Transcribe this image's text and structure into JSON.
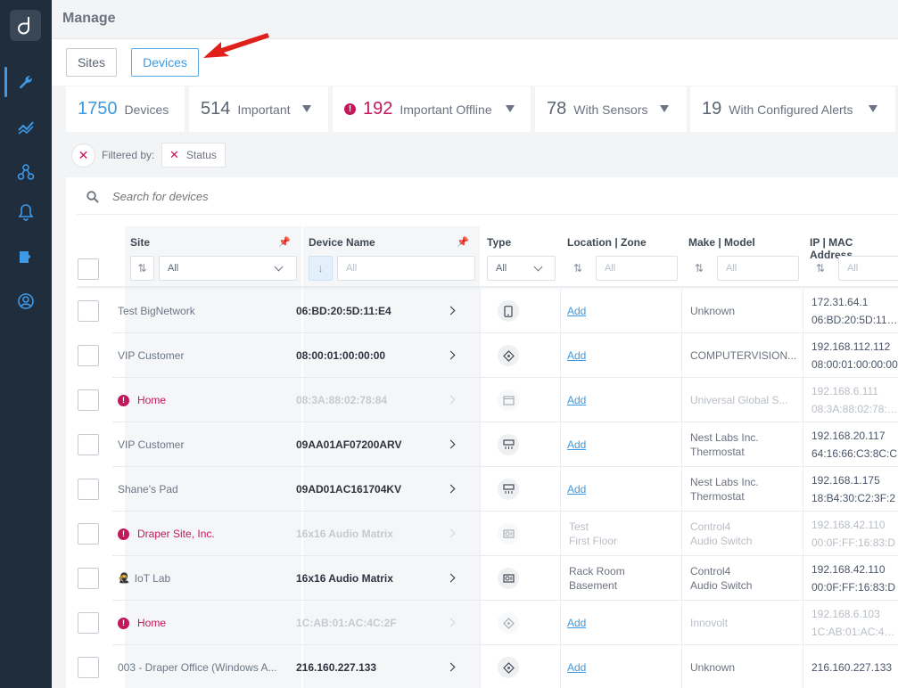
{
  "page": {
    "title": "Manage"
  },
  "tabs": [
    {
      "label": "Sites"
    },
    {
      "label": "Devices"
    }
  ],
  "stats": [
    {
      "value": "1750",
      "label": "Devices",
      "color": "#3d9ae0"
    },
    {
      "value": "514",
      "label": "Important",
      "color": "#5a6472"
    },
    {
      "value": "192",
      "label": "Important Offline",
      "color": "#c2185b"
    },
    {
      "value": "78",
      "label": "With Sensors",
      "color": "#5a6472"
    },
    {
      "value": "19",
      "label": "With Configured Alerts",
      "color": "#5a6472"
    }
  ],
  "filter": {
    "prefix": "Filtered by:",
    "chip": "Status"
  },
  "search": {
    "placeholder": "Search for devices"
  },
  "columns": {
    "site": "Site",
    "device_name": "Device Name",
    "type": "Type",
    "location": "Location | Zone",
    "make": "Make | Model",
    "ip": "IP | MAC Address"
  },
  "column_filters": {
    "site": "All",
    "device_name": "All",
    "type": "All",
    "location": "All",
    "make": "All",
    "ip": "All"
  },
  "rows": [
    {
      "site": "Test BigNetwork",
      "site_icon": "",
      "name": "06:BD:20:5D:11:E4",
      "type_icon": "phone-icon",
      "location": "Add",
      "zone": "",
      "make": "Unknown",
      "model": "",
      "ip": "172.31.64.1",
      "mac": "06:BD:20:5D:11:E4",
      "offline": false
    },
    {
      "site": "VIP Customer",
      "site_icon": "",
      "name": "08:00:01:00:00:00",
      "type_icon": "network-device-icon",
      "location": "Add",
      "zone": "",
      "make": "COMPUTERVISION...",
      "model": "",
      "ip": "192.168.112.112",
      "mac": "08:00:01:00:00:00",
      "offline": false
    },
    {
      "site": "Home",
      "site_icon": "!",
      "name": "08:3A:88:02:78:84",
      "type_icon": "screen-icon",
      "location": "Add",
      "zone": "",
      "make": "Universal Global S...",
      "model": "",
      "ip": "192.168.6.111",
      "mac": "08:3A:88:02:78:84",
      "offline": true
    },
    {
      "site": "VIP Customer",
      "site_icon": "",
      "name": "09AA01AF07200ARV",
      "type_icon": "thermostat-icon",
      "location": "Add",
      "zone": "",
      "make": "Nest Labs Inc.",
      "model": "Thermostat",
      "ip": "192.168.20.117",
      "mac": "64:16:66:C3:8C:C",
      "offline": false
    },
    {
      "site": "Shane's Pad",
      "site_icon": "",
      "name": "09AD01AC161704KV",
      "type_icon": "thermostat-icon",
      "location": "Add",
      "zone": "",
      "make": "Nest Labs Inc.",
      "model": "Thermostat",
      "ip": "192.168.1.175",
      "mac": "18:B4:30:C2:3F:2",
      "offline": false
    },
    {
      "site": "Draper Site, Inc.",
      "site_icon": "!",
      "name": "16x16 Audio Matrix",
      "type_icon": "audio-switch-icon",
      "location": "Test",
      "zone": "First Floor",
      "make": "Control4",
      "model": "Audio Switch",
      "ip": "192.168.42.110",
      "mac": "00:0F:FF:16:83:D",
      "offline": true
    },
    {
      "site": "IoT Lab",
      "site_icon": "ninja",
      "name": "16x16 Audio Matrix",
      "type_icon": "audio-switch-icon",
      "location": "Rack Room",
      "zone": "Basement",
      "make": "Control4",
      "model": "Audio Switch",
      "ip": "192.168.42.110",
      "mac": "00:0F:FF:16:83:D",
      "offline": false
    },
    {
      "site": "Home",
      "site_icon": "!",
      "name": "1C:AB:01:AC:4C:2F",
      "type_icon": "network-device-icon",
      "location": "Add",
      "zone": "",
      "make": "Innovolt",
      "model": "",
      "ip": "192.168.6.103",
      "mac": "1C:AB:01:AC:4C:2",
      "offline": true
    },
    {
      "site": "003 - Draper Office (Windows A...",
      "site_icon": "",
      "name": "216.160.227.133",
      "type_icon": "network-device-icon",
      "location": "Add",
      "zone": "",
      "make": "Unknown",
      "model": "",
      "ip": "216.160.227.133",
      "mac": "",
      "offline": false
    }
  ]
}
